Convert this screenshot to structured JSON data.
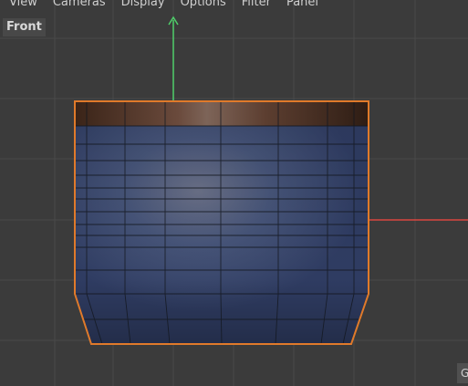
{
  "menu": {
    "items": [
      "View",
      "Cameras",
      "Display",
      "Options",
      "Filter",
      "Panel"
    ]
  },
  "viewport": {
    "label": "Front",
    "corner_label": "G"
  },
  "colors": {
    "background": "#3b3b3b",
    "grid": "#4a4a4a",
    "selection_outline": "#e07a2a",
    "axis_y": "#4fcf6a",
    "axis_x": "#d9463f",
    "mesh_top": "#5a3a2a",
    "mesh_body": "#3b4a70"
  }
}
